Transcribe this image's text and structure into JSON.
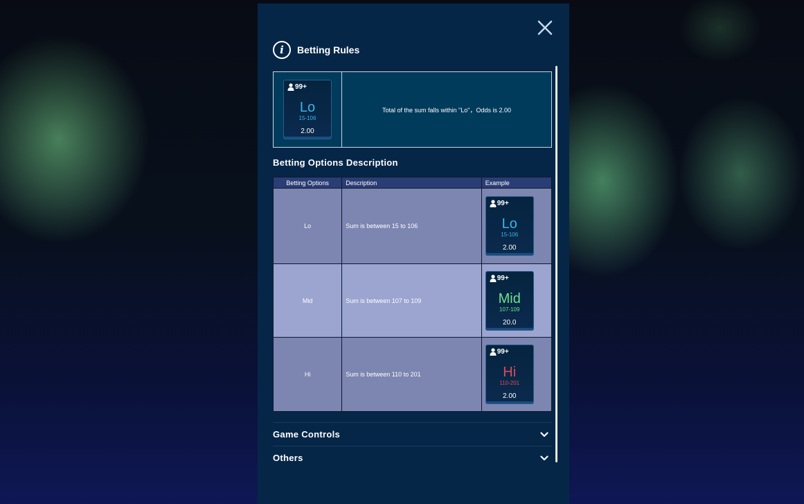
{
  "modal": {
    "title": "Betting Rules",
    "rule_text": "Total of the sum falls within \"Lo\"，Odds is 2.00",
    "section_title": "Betting Options Description",
    "table_headers": [
      "Betting Options",
      "Description",
      "Example"
    ],
    "rows": [
      {
        "option": "Lo",
        "description": "Sum is between 15 to 106",
        "card": {
          "label": "Lo",
          "range": "15-106",
          "odds": "2.00",
          "players": "99+"
        }
      },
      {
        "option": "Mid",
        "description": "Sum is between 107 to 109",
        "card": {
          "label": "Mid",
          "range": "107-109",
          "odds": "20.0",
          "players": "99+"
        }
      },
      {
        "option": "Hi",
        "description": "Sum is between 110 to 201",
        "card": {
          "label": "Hi",
          "range": "110-201",
          "odds": "2.00",
          "players": "99+"
        }
      }
    ],
    "rule_card": {
      "label": "Lo",
      "range": "15-106",
      "odds": "2.00",
      "players": "99+"
    },
    "accordions": [
      "Game Controls",
      "Others"
    ]
  },
  "colors": {
    "lo": "#38b6e8",
    "mid": "#6ee28a",
    "hi": "#e04a5a",
    "panel": "#062648"
  }
}
